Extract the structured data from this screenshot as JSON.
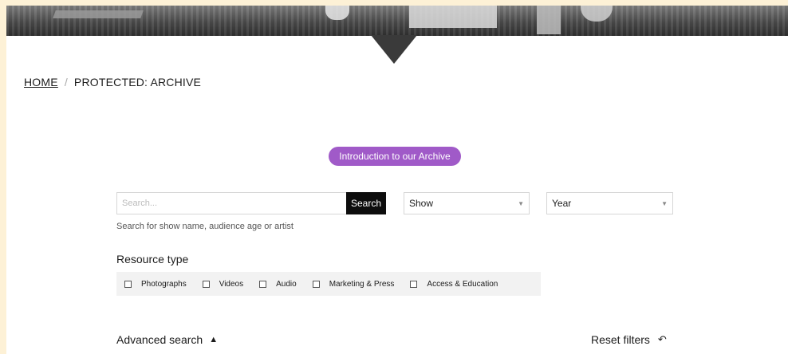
{
  "breadcrumb": {
    "home": "HOME",
    "separator": "/",
    "current": "PROTECTED: ARCHIVE"
  },
  "intro_button": {
    "label": "Introduction to our Archive",
    "color": "#a05ac8"
  },
  "search": {
    "placeholder": "Search...",
    "button_label": "Search",
    "hint": "Search for show name, audience age or artist"
  },
  "filters": {
    "show": {
      "selected": "Show"
    },
    "year": {
      "selected": "Year"
    }
  },
  "resource_type": {
    "title": "Resource type",
    "items": [
      "Photographs",
      "Videos",
      "Audio",
      "Marketing & Press",
      "Access & Education"
    ]
  },
  "advanced": {
    "label": "Advanced search",
    "icon": "chevron-up-icon"
  },
  "reset": {
    "label": "Reset filters",
    "icon": "undo-icon"
  }
}
